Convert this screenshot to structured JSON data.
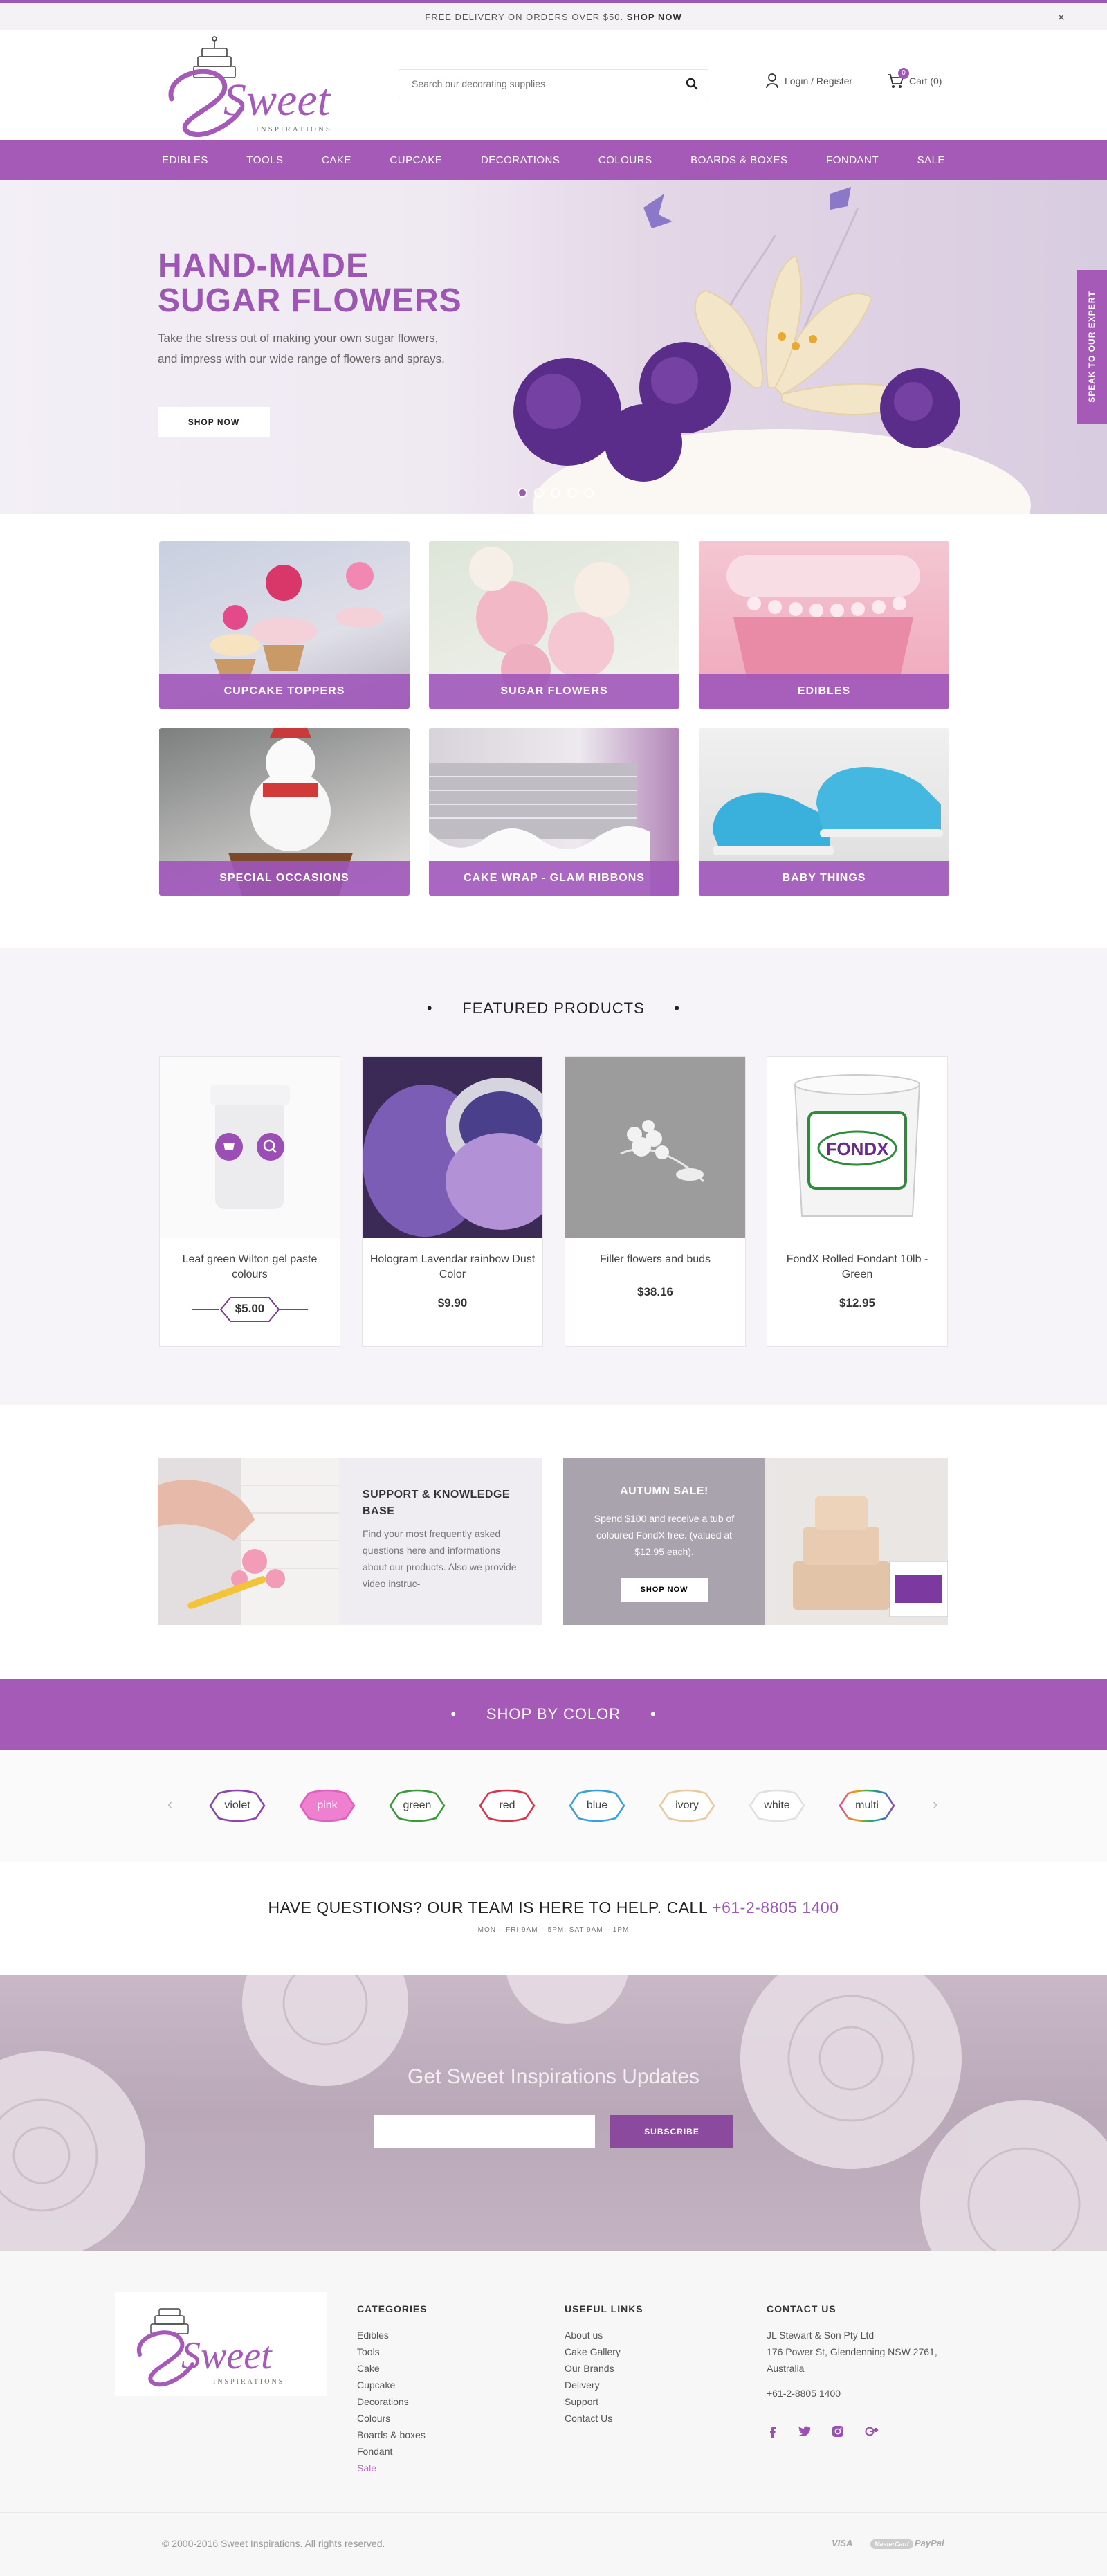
{
  "announcement": {
    "text": "FREE DELIVERY ON ORDERS OVER $50.",
    "link": "SHOP NOW",
    "close": "×"
  },
  "brand": {
    "name": "Sweet",
    "tagline": "INSPIRATIONS",
    "color": "#a55ab8"
  },
  "search": {
    "placeholder": "Search our decorating supplies",
    "icon": "search-icon"
  },
  "account": {
    "login_label": "Login / Register",
    "cart_label": "Cart (0)",
    "cart_count": "0"
  },
  "nav": {
    "items": [
      "EDIBLES",
      "TOOLS",
      "CAKE",
      "CUPCAKE",
      "DECORATIONS",
      "COLOURS",
      "BOARDS & BOXES",
      "FONDANT",
      "SALE"
    ]
  },
  "hero": {
    "title_line1": "HAND-MADE",
    "title_line2": "SUGAR FLOWERS",
    "text": "Take the stress out of making your own sugar flowers, and impress with our wide range of flowers and sprays.",
    "button": "SHOP NOW",
    "slides": 5,
    "active_slide": 1
  },
  "expert_tab": "SPEAK TO OUR EXPERT",
  "categories": [
    "CUPCAKE TOPPERS",
    "SUGAR FLOWERS",
    "EDIBLES",
    "SPECIAL OCCASIONS",
    "CAKE WRAP - GLAM RIBBONS",
    "BABY THINGS"
  ],
  "featured": {
    "title": "FEATURED PRODUCTS",
    "products": [
      {
        "name": "Leaf green Wilton gel paste colours",
        "price": "$5.00"
      },
      {
        "name": "Hologram Lavendar rainbow Dust Color",
        "price": "$9.90"
      },
      {
        "name": "Filler flowers and buds",
        "price": "$38.16"
      },
      {
        "name": "FondX Rolled Fondant 10lb - Green",
        "price": "$12.95"
      }
    ]
  },
  "promos": {
    "support": {
      "title": "SUPPORT & KNOWLEDGE BASE",
      "text": "Find your most frequently asked questions here and informations about our products. Also we provide video instruc-"
    },
    "autumn": {
      "title": "AUTUMN SALE!",
      "text": "Spend $100 and receive a tub of coloured FondX free. (valued at $12.95 each).",
      "button": "SHOP NOW"
    }
  },
  "shop_by_color": {
    "title": "SHOP BY COLOR",
    "colors": [
      {
        "label": "violet",
        "color": "#8e44ad"
      },
      {
        "label": "pink",
        "color": "#e060c0"
      },
      {
        "label": "green",
        "color": "#3a9a3a"
      },
      {
        "label": "red",
        "color": "#d9334a"
      },
      {
        "label": "blue",
        "color": "#3aa0d8"
      },
      {
        "label": "ivory",
        "color": "#e8c9a0"
      },
      {
        "label": "white",
        "color": "#e0e0e0"
      },
      {
        "label": "multi",
        "color": "#e84393"
      }
    ]
  },
  "questions": {
    "text": "HAVE QUESTIONS? OUR TEAM IS HERE TO HELP. CALL",
    "phone": "+61-2-8805 1400",
    "hours": "MON – FRI 9AM – 5PM, SAT 9AM – 1PM"
  },
  "newsletter": {
    "title": "Get Sweet Inspirations Updates",
    "button": "SUBSCRIBE"
  },
  "footer": {
    "categories_title": "CATEGORIES",
    "categories": [
      "Edibles",
      "Tools",
      "Cake",
      "Cupcake",
      "Decorations",
      "Colours",
      "Boards & boxes",
      "Fondant",
      "Sale"
    ],
    "links_title": "USEFUL LINKS",
    "links": [
      "About us",
      "Cake Gallery",
      "Our Brands",
      "Delivery",
      "Support",
      "Contact Us"
    ],
    "contact_title": "CONTACT US",
    "company": "JL Stewart & Son Pty Ltd",
    "address1": "176 Power St, Glendenning NSW 2761,",
    "address2": "Australia",
    "phone": "+61-2-8805 1400",
    "social": [
      "facebook-icon",
      "twitter-icon",
      "instagram-icon",
      "google-plus-icon"
    ],
    "copyright": "© 2000-2016 Sweet Inspirations. All rights reserved.",
    "payments": [
      "VISA",
      "MasterCard",
      "PayPal"
    ]
  }
}
